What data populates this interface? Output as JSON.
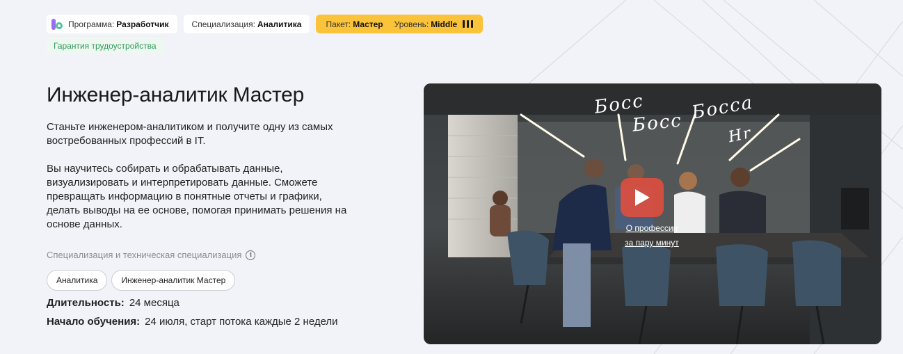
{
  "tags": {
    "program_label": "Программа:",
    "program_value": "Разработчик",
    "specialization_label": "Специализация:",
    "specialization_value": "Аналитика",
    "package_label": "Пакет:",
    "package_value": "Мастер",
    "level_label": "Уровень:",
    "level_value": "Middle",
    "level_bars": 3,
    "package_color": "#fbc33a"
  },
  "guarantee": "Гарантия трудоустройства",
  "title": "Инженер-аналитик Мастер",
  "description": {
    "p1": "Станьте инженером-аналитиком и получите одну из самых востребованных профессий в IT.",
    "p2": "Вы научитесь собирать и обрабатывать данные, визуализировать и интерпретировать данные. Сможете превращать информацию в понятные отчеты и графики, делать выводы на ее основе, помогая принимать решения на основе данных."
  },
  "specialization": {
    "label": "Специализация и техническая специализация",
    "chips": [
      "Аналитика",
      "Инженер-аналитик Мастер"
    ]
  },
  "duration": {
    "label": "Длительность:",
    "value": "24 месяца"
  },
  "start": {
    "label": "Начало обучения:",
    "value": "24 июля, старт потока каждые 2 недели"
  },
  "video": {
    "caption_line1": "О профессии",
    "caption_line2": "за пару минут",
    "scrawl1": "Босс",
    "scrawl2": "Босс",
    "scrawl3": "Босса",
    "scrawl4": "Hr",
    "play_color": "#e84d3c"
  },
  "icons": {
    "logo": "logo-icon",
    "info": "info-icon",
    "play": "play-icon"
  }
}
